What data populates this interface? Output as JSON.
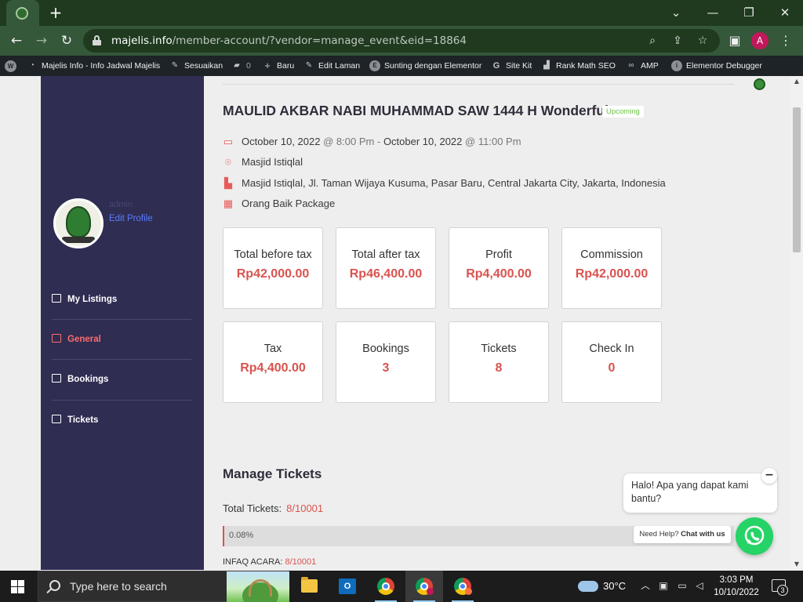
{
  "browser": {
    "tab_icon": "majelis-favicon",
    "new_tab_label": "+",
    "window_controls": {
      "dropdown": "⌄",
      "minimize": "—",
      "restore": "❐",
      "close": "✕"
    },
    "nav": {
      "back": "←",
      "forward": "→",
      "reload": "↻"
    },
    "url_host": "majelis.info",
    "url_path": "/member-account/?vendor=manage_event&eid=18864",
    "profile_initial": "A"
  },
  "adminbar": {
    "items": [
      {
        "label": "Majelis Info - Info Jadwal Majelis",
        "icon": "dashboard-icon"
      },
      {
        "label": "Sesuaikan",
        "icon": "brush-icon"
      },
      {
        "label": "0",
        "icon": "comment-icon"
      },
      {
        "label": "Baru",
        "icon": "plus-icon"
      },
      {
        "label": "Edit Laman",
        "icon": "pencil-icon"
      },
      {
        "label": "Sunting dengan Elementor",
        "icon": "elementor-icon"
      },
      {
        "label": "Site Kit",
        "icon": "google-icon"
      },
      {
        "label": "Rank Math SEO",
        "icon": "chart-icon"
      },
      {
        "label": "AMP",
        "icon": "link-icon"
      },
      {
        "label": "Elementor Debugger",
        "icon": "info-icon"
      }
    ]
  },
  "sidebar": {
    "profile_name": "admin",
    "edit_profile": "Edit Profile",
    "items": [
      {
        "label": "My Listings",
        "icon": "grid-icon",
        "active": false
      },
      {
        "label": "General",
        "icon": "home-icon",
        "active": true
      },
      {
        "label": "Bookings",
        "icon": "document-icon",
        "active": false
      },
      {
        "label": "Tickets",
        "icon": "list-icon",
        "active": false
      }
    ]
  },
  "event": {
    "title": "MAULID AKBAR NABI MUHAMMAD SAW 1444 H Wonderful",
    "status": "Upcoming",
    "start_date": "October 10, 2022",
    "start_time": "8:00 Pm",
    "end_date": "October 10, 2022",
    "end_time": "11:00 Pm",
    "at_symbol": "@",
    "dash": "-",
    "venue": "Masjid Istiqlal",
    "address": "Masjid Istiqlal, Jl. Taman Wijaya Kusuma, Pasar Baru, Central Jakarta City, Jakarta, Indonesia",
    "package": "Orang Baik Package"
  },
  "stats": [
    {
      "label": "Total before tax",
      "value": "Rp42,000.00"
    },
    {
      "label": "Total after tax",
      "value": "Rp46,400.00"
    },
    {
      "label": "Profit",
      "value": "Rp4,400.00"
    },
    {
      "label": "Commission",
      "value": "Rp42,000.00"
    },
    {
      "label": "Tax",
      "value": "Rp4,400.00"
    },
    {
      "label": "Bookings",
      "value": "3"
    },
    {
      "label": "Tickets",
      "value": "8"
    },
    {
      "label": "Check In",
      "value": "0"
    }
  ],
  "manage_tickets": {
    "title": "Manage Tickets",
    "total_label": "Total Tickets:",
    "total_value": "8/10001",
    "progress_text": "0.08%",
    "progress_fraction": 0.0008,
    "infaq_label": "INFAQ ACARA:",
    "infaq_value": "8/10001"
  },
  "chat": {
    "greeting": "Halo! Apa yang dapat kami bantu?",
    "close": "−",
    "help_prefix": "Need Help?",
    "help_link": "Chat with us"
  },
  "taskbar": {
    "search_placeholder": "Type here to search",
    "temperature": "30°C",
    "time": "3:03 PM",
    "date": "10/10/2022",
    "notification_count": "3",
    "outlook_letter": "O"
  },
  "colors": {
    "accent_red": "#d9534f",
    "sidebar_bg": "#2f2d52",
    "upcoming_green": "#6abf40",
    "whatsapp_green": "#25d366"
  }
}
